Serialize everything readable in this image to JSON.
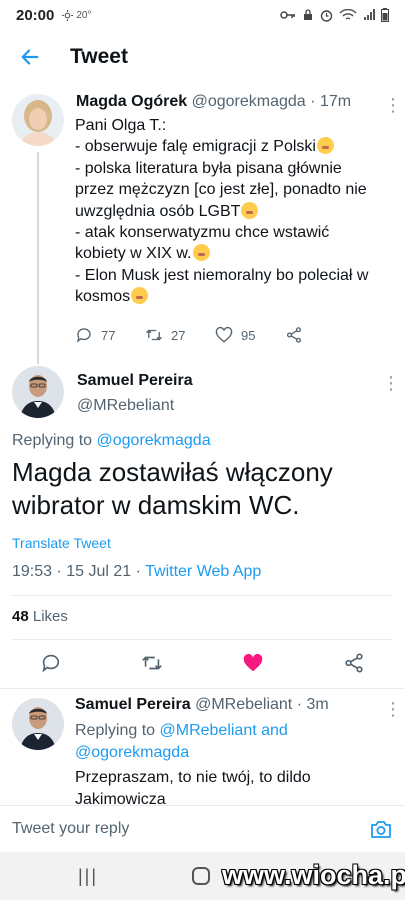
{
  "status_bar": {
    "time": "20:00",
    "temperature": "20°"
  },
  "header": {
    "title": "Tweet"
  },
  "tweet1": {
    "name": "Magda Ogórek",
    "handle": "@ogorekmagda",
    "time": "· 17m",
    "lines": [
      "Pani Olga T.:",
      "- obserwuje falę emigracji z Polski",
      "- polska literatura była pisana głównie",
      "przez mężczyzn [co jest złe], ponadto nie",
      "uwzględnia osób LGBT",
      "- atak konserwatyzmu chce wstawić",
      "kobiety w XIX w.",
      "- Elon Musk jest niemoralny bo poleciał w",
      "kosmos"
    ],
    "replies": "77",
    "retweets": "27",
    "likes": "95"
  },
  "tweet2": {
    "name": "Samuel Pereira",
    "handle": "@MRebeliant",
    "replying_prefix": "Replying to",
    "replying_to": "@ogorekmagda",
    "text": "Magda zostawiłaś włączony wibrator w damskim WC.",
    "translate": "Translate Tweet",
    "datetime": "19:53 · 15 Jul 21 · ",
    "source": "Twitter Web App",
    "likes_count": "48",
    "likes_label": "Likes",
    "like_color": "#f91880"
  },
  "tweet3": {
    "name": "Samuel Pereira",
    "handle": "@MRebeliant",
    "time": "· 3m",
    "replying_prefix": "Replying to",
    "replying_to_1": "@MRebeliant",
    "replying_and": "and",
    "replying_to_2": "@ogorekmagda",
    "text": "Przepraszam, to nie twój, to dildo Jakimowicza"
  },
  "reply_bar": {
    "placeholder": "Tweet your reply"
  },
  "watermark": "www.wiocha.pl",
  "colors": {
    "accent": "#1d9bf0",
    "like": "#f91880"
  }
}
